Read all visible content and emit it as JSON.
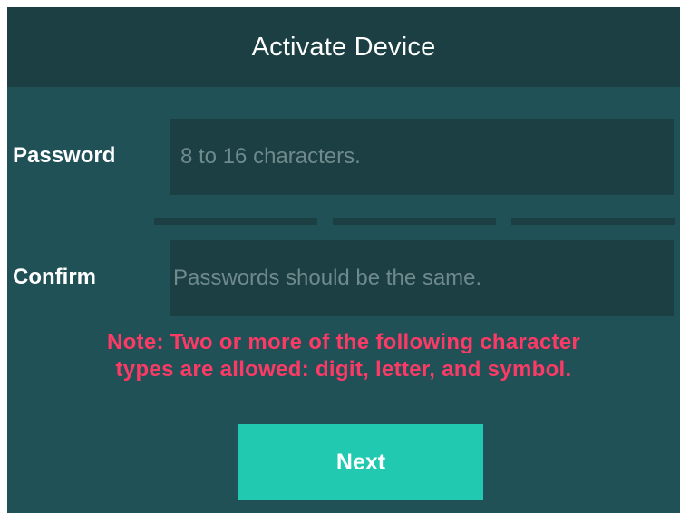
{
  "dialog": {
    "title": "Activate Device"
  },
  "password": {
    "label": "Password",
    "value": "",
    "placeholder": "8 to 16 characters."
  },
  "strength_meter": {
    "segments": 3
  },
  "confirm": {
    "label": "Confirm",
    "value": "",
    "placeholder": "Passwords should be the same."
  },
  "note": {
    "line1": "Note: Two or more of the following character",
    "line2": "types are allowed: digit, letter, and symbol."
  },
  "actions": {
    "next_label": "Next"
  },
  "colors": {
    "panel": "#1f5157",
    "title_bar": "#1b3f42",
    "field_bg": "#1b3f42",
    "note_text": "#fc3a66",
    "button": "#22c9b1"
  }
}
